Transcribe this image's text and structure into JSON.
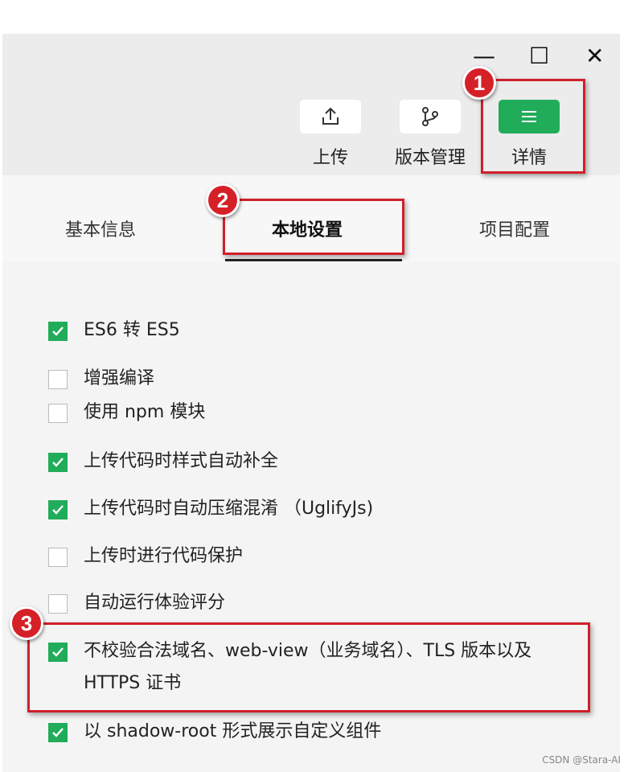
{
  "window_controls": {
    "minimize": "—",
    "maximize": "☐",
    "close": "✕"
  },
  "toolbar": {
    "upload_label": "上传",
    "version_label": "版本管理",
    "details_label": "详情"
  },
  "tabs": [
    {
      "label": "基本信息"
    },
    {
      "label": "本地设置"
    },
    {
      "label": "项目配置"
    }
  ],
  "options": [
    {
      "label": "ES6 转 ES5",
      "checked": true
    },
    {
      "label": "增强编译",
      "checked": false
    },
    {
      "label": "使用 npm 模块",
      "checked": false
    },
    {
      "label": "上传代码时样式自动补全",
      "checked": true
    },
    {
      "label": "上传代码时自动压缩混淆 （UglifyJs)",
      "checked": true
    },
    {
      "label": "上传时进行代码保护",
      "checked": false
    },
    {
      "label": "自动运行体验评分",
      "checked": false
    },
    {
      "label": "不校验合法域名、web-view（业务域名）、TLS 版本以及 HTTPS 证书",
      "checked": true
    },
    {
      "label": "以 shadow-root 形式展示自定义组件",
      "checked": true
    }
  ],
  "annotations": {
    "badge1": "1",
    "badge2": "2",
    "badge3": "3"
  },
  "watermark": "CSDN @Stara-AI",
  "colors": {
    "accent": "#21ac5a",
    "annotation_red": "#d0202a"
  }
}
